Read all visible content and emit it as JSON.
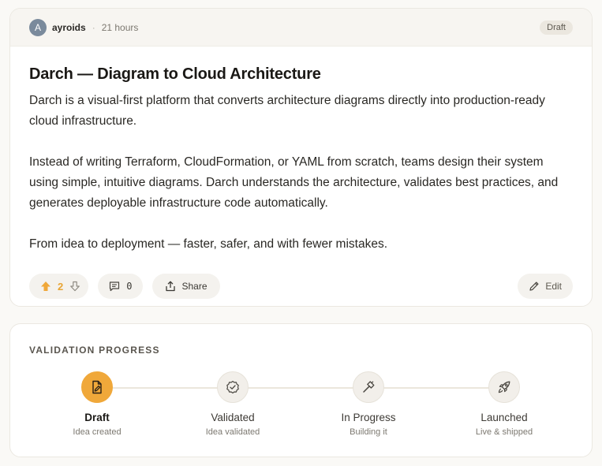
{
  "post": {
    "author_initial": "A",
    "author": "ayroids",
    "separator": "·",
    "time": "21 hours",
    "status": "Draft",
    "title": "Darch — Diagram to Cloud Architecture",
    "paragraphs": [
      "Darch is a visual-first platform that converts architecture diagrams directly into production-ready cloud infrastructure.",
      "Instead of writing Terraform, CloudFormation, or YAML from scratch, teams design their system using simple, intuitive diagrams. Darch understands the architecture, validates best practices, and generates deployable infrastructure code automatically.",
      "From idea to deployment — faster, safer, and with fewer mistakes."
    ]
  },
  "actions": {
    "upvotes": "2",
    "comments": "0",
    "share_label": "Share",
    "edit_label": "Edit"
  },
  "progress": {
    "title": "VALIDATION PROGRESS",
    "current_step": 0,
    "steps": [
      {
        "label": "Draft",
        "sub": "Idea created",
        "icon": "file-pen-icon"
      },
      {
        "label": "Validated",
        "sub": "Idea validated",
        "icon": "badge-check-icon"
      },
      {
        "label": "In Progress",
        "sub": "Building it",
        "icon": "hammer-icon"
      },
      {
        "label": "Launched",
        "sub": "Live & shipped",
        "icon": "rocket-icon"
      }
    ]
  },
  "colors": {
    "accent": "#f0a83a",
    "accent_text": "#e8a534",
    "background": "#faf9f6"
  }
}
